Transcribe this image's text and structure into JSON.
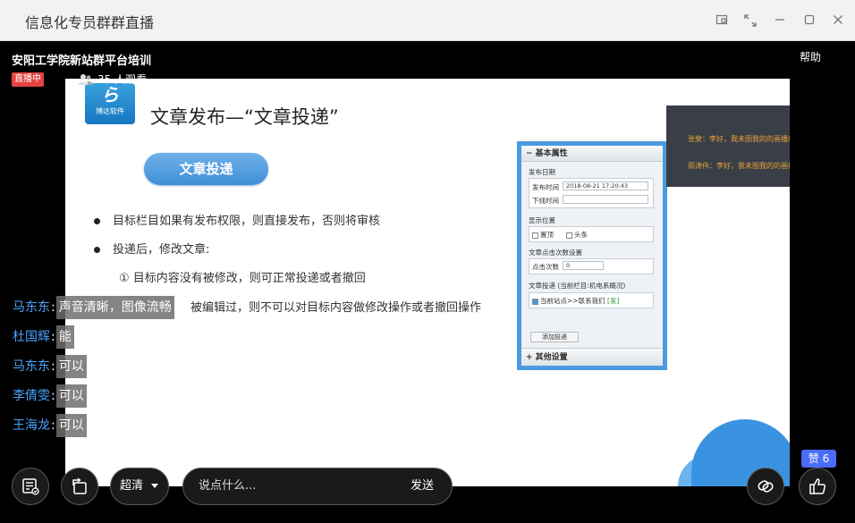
{
  "window": {
    "title": "信息化专员群群直播",
    "controls": [
      "popout-icon",
      "fullscreen-icon",
      "minimize-icon",
      "maximize-icon",
      "close-icon"
    ]
  },
  "live": {
    "title": "安阳工学院新站群平台培训",
    "status": "直播中",
    "viewers": "35 人观看",
    "help": "帮助"
  },
  "slide": {
    "logo_text": "博达软件",
    "title": "文章发布—“文章投递”",
    "pill": "文章投递",
    "bullets": [
      "目标栏目如果有发布权限，则直接发布，否则将审核",
      "投递后，修改文章:",
      "①  目标内容没有被修改，则可正常投递或者撤回",
      "被编辑过，则不可以对目标内容做修改操作或者撤回操作"
    ]
  },
  "panel": {
    "header": "− 基本属性",
    "publish_date_label": "发布日期",
    "publish_time_label": "发布时间",
    "publish_time_value": "2018-08-21 17:20:43",
    "offline_time_label": "下线时间",
    "display_position_label": "显示位置",
    "pin_label": "置顶",
    "headline_label": "头条",
    "click_count_setting_label": "文章点击次数设置",
    "click_count_label": "点击次数",
    "click_count_value": "0",
    "delivery_label": "文章投递 (当前栏目:机电系概况)",
    "delivery_target": "当前站点>>联系我们",
    "delivery_target_tag": "[发]",
    "add_button": "添加投递",
    "footer": "+ 其他设置"
  },
  "overlay": {
    "line1": "张斐：李好，我未图我的的画播般，大",
    "line2": "雨涛伟：李好，我未图我的的画播般，"
  },
  "chat": [
    {
      "name": "马东东",
      "msg": "声音清晰，图像流畅"
    },
    {
      "name": "杜国辉",
      "msg": "能"
    },
    {
      "name": "马东东",
      "msg": "可以"
    },
    {
      "name": "李倩雯",
      "msg": "可以"
    },
    {
      "name": "王海龙",
      "msg": "可以"
    }
  ],
  "controls": {
    "quality": "超清",
    "chat_placeholder": "说点什么...",
    "send": "发送",
    "like_count": "赞 6"
  },
  "colors": {
    "live_badge": "#e64340",
    "chat_name": "#4aa3ff",
    "like_badge": "#4a6cf7",
    "panel_border": "#4a9be0"
  }
}
